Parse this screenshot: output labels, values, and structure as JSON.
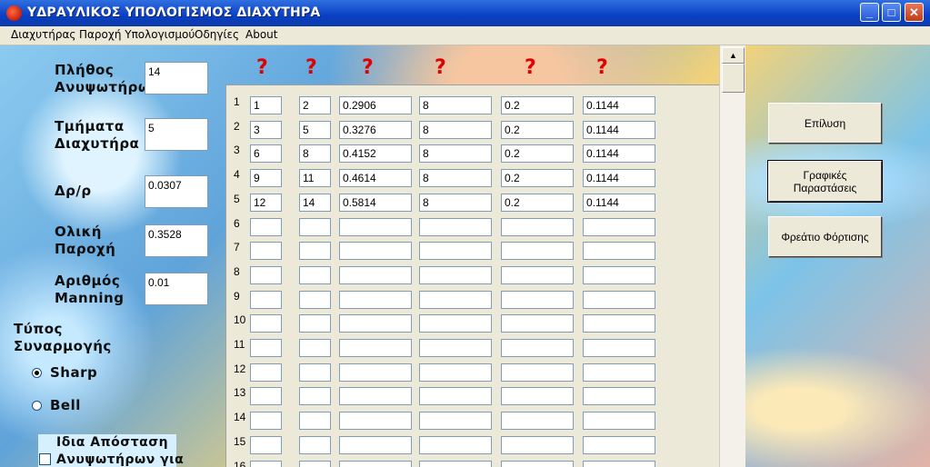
{
  "window": {
    "title": "ΥΔΡΑΥΛΙΚΟΣ ΥΠΟΛΟΓΙΣΜΟΣ ΔΙΑΧΥΤΗΡΑ",
    "icon": "app-icon",
    "controls": {
      "minimize": "_",
      "maximize": "□",
      "close": "✕"
    }
  },
  "menu": [
    "Διαχυτήρας",
    "Παροχή Υπολογισμού",
    "Οδηγίες",
    "About"
  ],
  "inputs": {
    "num_risers": {
      "label_line1": "Πλήθος",
      "label_line2": "Ανυψωτήρων",
      "value": "14"
    },
    "sections": {
      "label_line1": "Τμήματα",
      "label_line2": "Διαχυτήρα",
      "value": "5"
    },
    "dr_ratio": {
      "label": "Δρ/ρ",
      "value": "0.0307"
    },
    "total_flow": {
      "label_line1": "Ολική",
      "label_line2": "Παροχή",
      "value": "0.3528"
    },
    "manning": {
      "label_line1": "Αριθμός",
      "label_line2": "Manning",
      "value": "0.01"
    }
  },
  "connection": {
    "title_line1": "Τύπος",
    "title_line2": "Συναρμογής",
    "options": [
      {
        "label": "Sharp",
        "selected": true
      },
      {
        "label": "Bell",
        "selected": false
      }
    ]
  },
  "equal_distance": {
    "line1": "Ιδια Απόσταση",
    "line2": "Ανυψωτήρων για",
    "checked": false
  },
  "help_marks": [
    "?",
    "?",
    "?",
    "?",
    "?",
    "?"
  ],
  "table": {
    "row_numbers": [
      "1",
      "2",
      "3",
      "4",
      "5",
      "6",
      "7",
      "8",
      "9",
      "10",
      "11",
      "12",
      "13",
      "14",
      "15",
      "16"
    ],
    "rows": [
      [
        "1",
        "2",
        "0.2906",
        "8",
        "0.2",
        "0.1144"
      ],
      [
        "3",
        "5",
        "0.3276",
        "8",
        "0.2",
        "0.1144"
      ],
      [
        "6",
        "8",
        "0.4152",
        "8",
        "0.2",
        "0.1144"
      ],
      [
        "9",
        "11",
        "0.4614",
        "8",
        "0.2",
        "0.1144"
      ],
      [
        "12",
        "14",
        "0.5814",
        "8",
        "0.2",
        "0.1144"
      ]
    ]
  },
  "buttons": {
    "solve": "Επίλυση",
    "charts_line1": "Γραφικές",
    "charts_line2": "Παραστάσεις",
    "loading_well": "Φρεάτιο Φόρτισης"
  },
  "colors": {
    "titlebar": "#0a3fc4",
    "help_mark": "#e00000"
  }
}
